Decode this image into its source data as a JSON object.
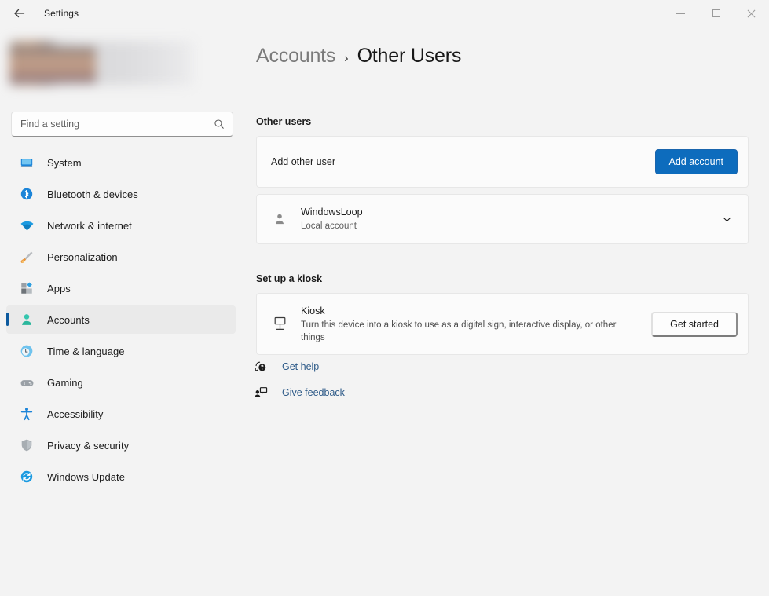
{
  "titlebar": {
    "back_label": "back-arrow",
    "app_title": "Settings",
    "minimize": "minimize",
    "maximize": "maximize",
    "close": "close"
  },
  "sidebar": {
    "profile": {
      "blurred": "true",
      "name": "",
      "email": ""
    },
    "search": {
      "placeholder": "Find a setting",
      "value": "",
      "icon": "search-icon"
    },
    "items": [
      {
        "label": "System",
        "icon": "monitor-icon",
        "selected": false
      },
      {
        "label": "Bluetooth & devices",
        "icon": "bluetooth-icon",
        "selected": false
      },
      {
        "label": "Network & internet",
        "icon": "wifi-icon",
        "selected": false
      },
      {
        "label": "Personalization",
        "icon": "paintbrush-icon",
        "selected": false
      },
      {
        "label": "Apps",
        "icon": "apps-icon",
        "selected": false
      },
      {
        "label": "Accounts",
        "icon": "person-icon",
        "selected": true
      },
      {
        "label": "Time & language",
        "icon": "clock-globe-icon",
        "selected": false
      },
      {
        "label": "Gaming",
        "icon": "gamepad-icon",
        "selected": false
      },
      {
        "label": "Accessibility",
        "icon": "accessibility-icon",
        "selected": false
      },
      {
        "label": "Privacy & security",
        "icon": "shield-icon",
        "selected": false
      },
      {
        "label": "Windows Update",
        "icon": "update-icon",
        "selected": false
      }
    ]
  },
  "main": {
    "breadcrumb": {
      "parent": "Accounts",
      "separator": "›",
      "current": "Other Users"
    },
    "sections": {
      "other_users": {
        "heading": "Other users",
        "add_other_user": {
          "label": "Add other user",
          "button": "Add account"
        },
        "user": {
          "name": "WindowsLoop",
          "account_type": "Local account",
          "expander": "chevron-down-icon"
        }
      },
      "kiosk": {
        "heading": "Set up a kiosk",
        "title": "Kiosk",
        "description": "Turn this device into a kiosk to use as a digital sign, interactive display, or other things",
        "button": "Get started"
      }
    },
    "links": [
      {
        "label": "Get help",
        "icon": "help-icon"
      },
      {
        "label": "Give feedback",
        "icon": "feedback-icon"
      }
    ]
  },
  "colors": {
    "accent": "#0d6cbd",
    "selection_indicator": "#0d5a9e",
    "link": "#2d5a88",
    "page_bg": "#f3f3f3",
    "card_bg": "#fbfbfb"
  }
}
